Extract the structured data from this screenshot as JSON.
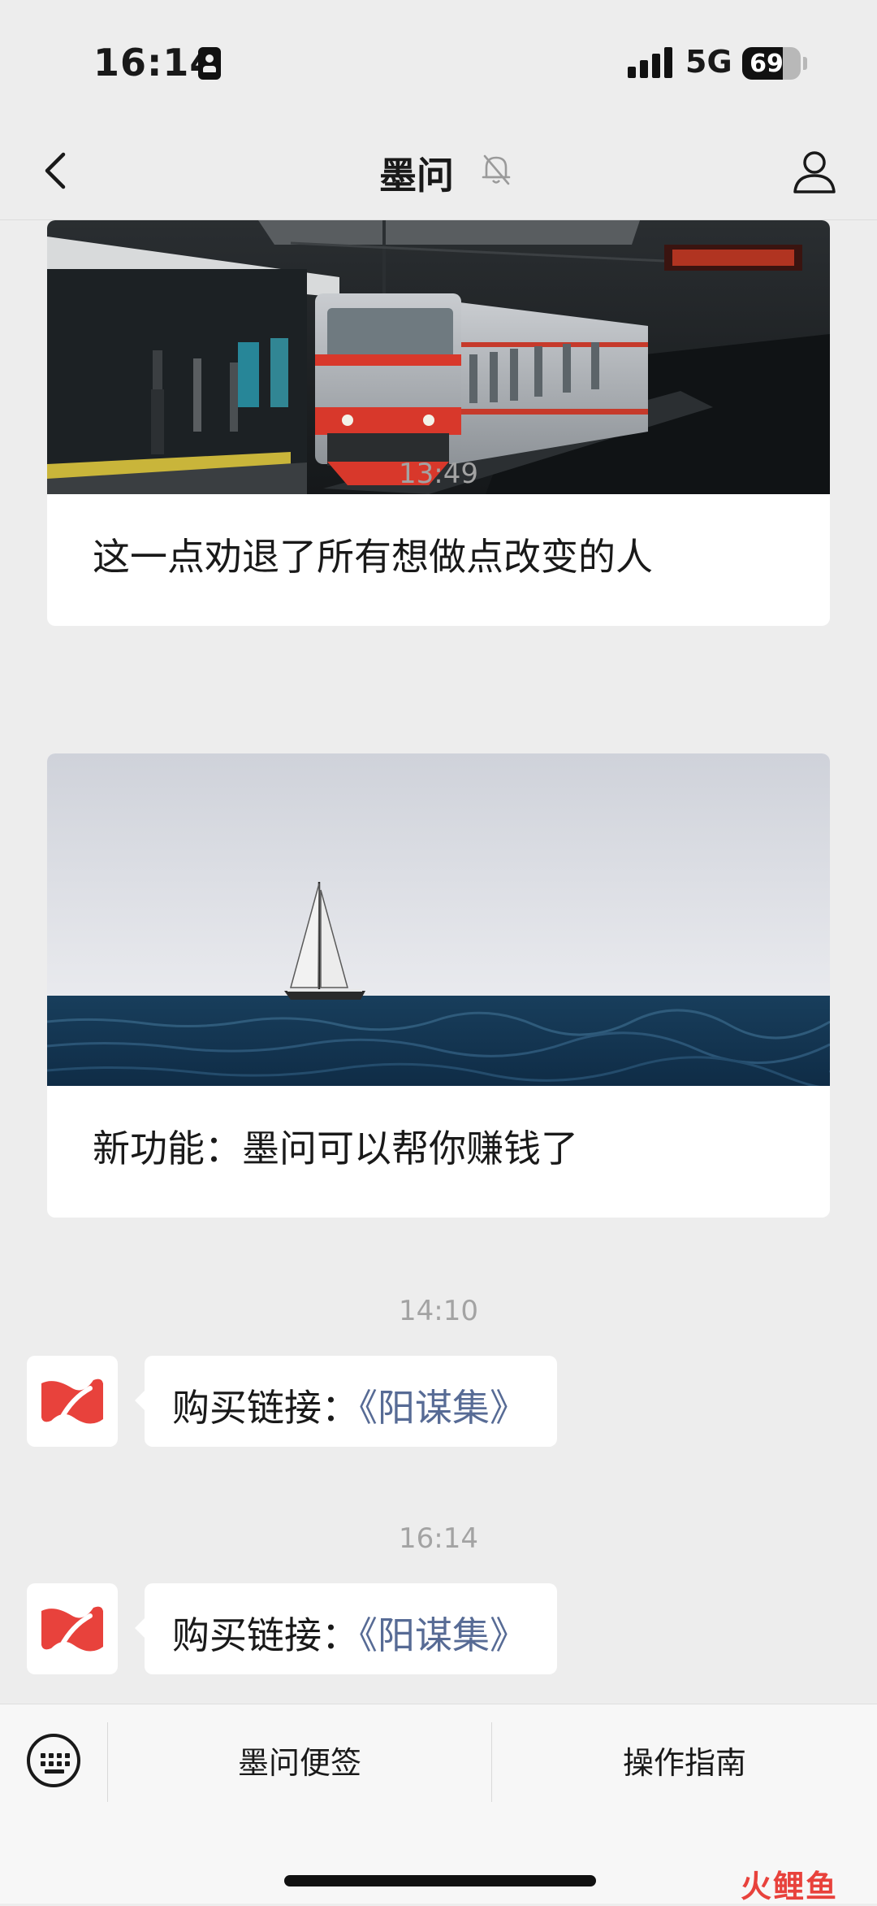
{
  "status_bar": {
    "time": "16:14",
    "network": "5G",
    "battery": "69",
    "battery_level": 0.69
  },
  "nav": {
    "title": "墨问"
  },
  "chat": {
    "cards": [
      {
        "title": "这一点劝退了所有想做点改变的人"
      },
      {
        "title": "新功能：墨问可以帮你赚钱了"
      }
    ],
    "timestamps": [
      "13:49",
      "14:10",
      "16:14"
    ],
    "messages": [
      {
        "prefix": "购买链接：",
        "link": "《阳谋集》"
      },
      {
        "prefix": "购买链接：",
        "link": "《阳谋集》"
      }
    ]
  },
  "menu": {
    "items": [
      "墨问便签",
      "操作指南"
    ]
  },
  "watermark": "火鲤鱼",
  "colors": {
    "background": "#ededed",
    "link": "#576b95",
    "brand": "#e8423c",
    "train_red": "#d8382b"
  }
}
